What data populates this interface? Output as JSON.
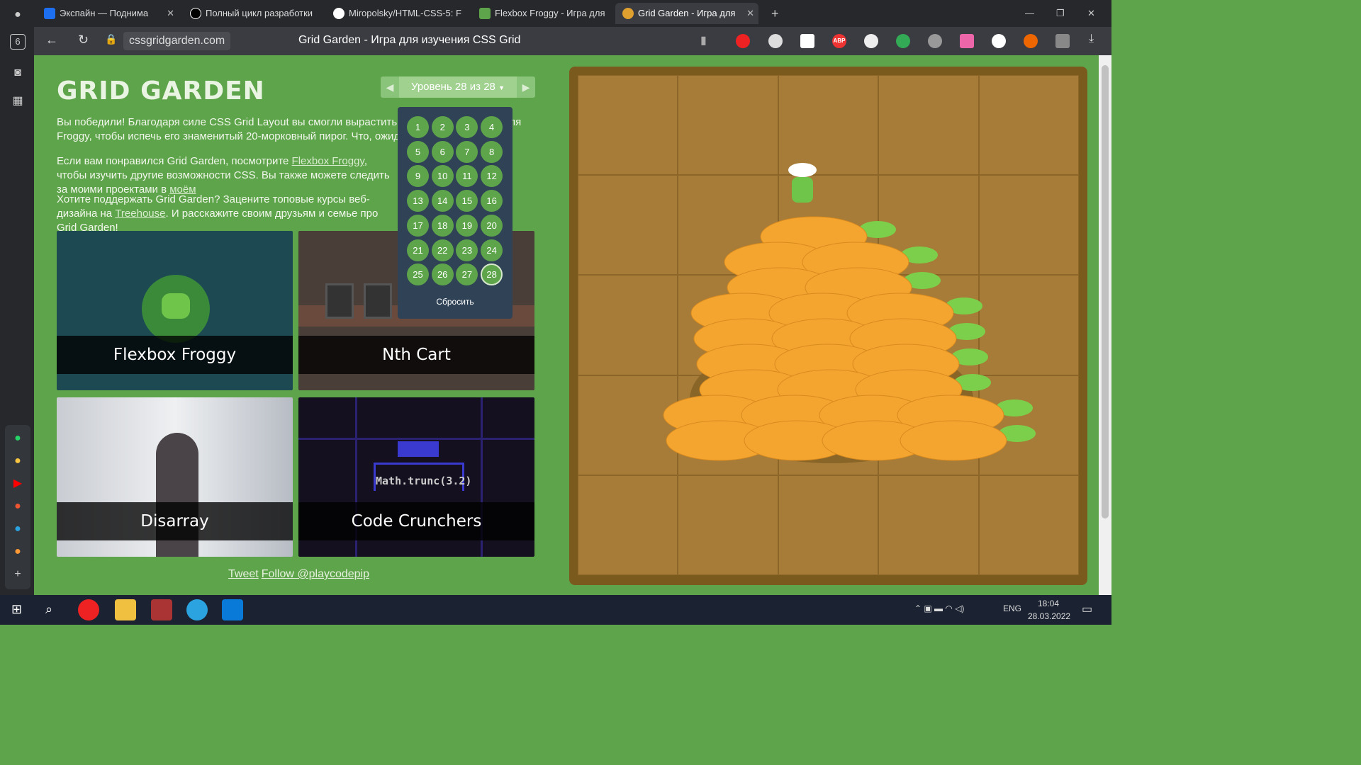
{
  "browser": {
    "tabs": [
      {
        "label": "Экспайн — Поднима",
        "color": "#1e6ff0"
      },
      {
        "label": "Полный цикл разработки",
        "color": "#000000"
      },
      {
        "label": "Miropolsky/HTML-CSS-5: F",
        "color": "#ffffff"
      },
      {
        "label": "Flexbox Froggy - Игра для",
        "color": "#5ea44a"
      },
      {
        "label": "Grid Garden - Игра для",
        "color": "#e0a030"
      }
    ],
    "sidebar_badge": "6",
    "url": "cssgridgarden.com",
    "page_title": "Grid Garden - Игра для изучения CSS Grid",
    "extensions": [
      "youtube",
      "ball",
      "VK",
      "ABP",
      "ext",
      "shield",
      "bulb",
      "gradient",
      "W",
      "C",
      "translate",
      "download"
    ]
  },
  "page": {
    "title": "GRID GARDEN",
    "level_label": "Уровень 28 из 28",
    "levels": [
      "1",
      "2",
      "3",
      "4",
      "5",
      "6",
      "7",
      "8",
      "9",
      "10",
      "11",
      "12",
      "13",
      "14",
      "15",
      "16",
      "17",
      "18",
      "19",
      "20",
      "21",
      "22",
      "23",
      "24",
      "25",
      "26",
      "27",
      "28"
    ],
    "current_level": "28",
    "reset_label": "Сбросить",
    "p1": "Вы победили! Благодаря силе CSS Grid Layout вы смогли вырастить достаточно моркови для Froggy, чтобы испечь его знаменитый 20-морковный пирог. Что, ожидали другого?",
    "p2_a": "Если вам понравился Grid Garden, посмотрите ",
    "p2_link": "Flexbox Froggy",
    "p2_b": ", чтобы изучить другие возможности CSS. Вы также можете следить за моими проектами в ",
    "p2_link2": "моём",
    "p3_a": "Хотите поддержать Grid Garden? Зацените топовые курсы веб-дизайна на ",
    "p3_link": "Treehouse",
    "p3_b": ". И расскажите своим друзьям и семье про Grid Garden!",
    "cards": [
      "Flexbox Froggy",
      "Nth Cart",
      "Disarray",
      "Code Crunchers"
    ],
    "code_text": "Math.trunc(3.2)",
    "tweet": "Tweet",
    "follow": "Follow @playcodepip"
  },
  "taskbar": {
    "lang": "ENG",
    "time": "18:04",
    "date": "28.03.2022"
  }
}
